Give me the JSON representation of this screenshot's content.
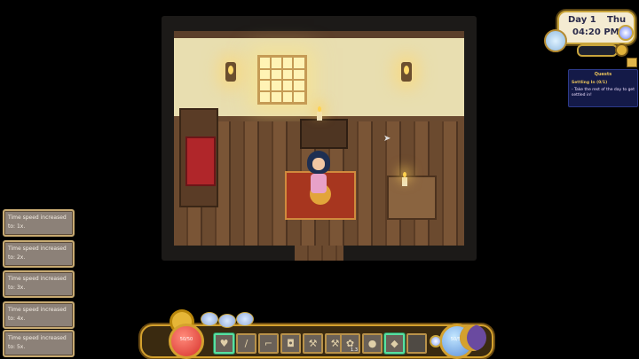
{
  "clock": {
    "day": "Day 1",
    "day_of_week": "Thu",
    "time": "04:20 PM"
  },
  "quests": {
    "header": "Quests",
    "title": "Settling In (0/1)",
    "description": "- Take the rest of the day to get settled in!"
  },
  "notifications": [
    {
      "text": "Time speed increased to: 1x."
    },
    {
      "text": "Time speed increased to: 2x."
    },
    {
      "text": "Time speed increased to: 3x."
    },
    {
      "text": "Time speed increased to: 4x."
    },
    {
      "text": "Time speed increased to: 5x."
    }
  ],
  "hotbar": {
    "health_label": "50/50",
    "mana_label": "50/50",
    "slots": [
      {
        "name": "heart-item",
        "icon": "♥",
        "count": ""
      },
      {
        "name": "wand-tool",
        "icon": "/",
        "count": ""
      },
      {
        "name": "hoe-tool",
        "icon": "⌐",
        "count": ""
      },
      {
        "name": "watering-can-tool",
        "icon": "◘",
        "count": ""
      },
      {
        "name": "axe-tool",
        "icon": "⚒",
        "count": ""
      },
      {
        "name": "hammer-tool",
        "icon": "⚒",
        "count": ""
      },
      {
        "name": "seed-item",
        "icon": "✿",
        "count": "1.3"
      },
      {
        "name": "stone-item",
        "icon": "●",
        "count": ""
      },
      {
        "name": "gem-item",
        "icon": "◆",
        "count": ""
      },
      {
        "name": "empty-slot",
        "icon": "",
        "count": ""
      }
    ]
  },
  "colors": {
    "quest_bg": "#141a48",
    "quest_text": "#e8c25a",
    "notification_bg": "#8c8178",
    "frame_gold": "#d4a12e",
    "health": "#d7322c",
    "mana": "#5a8ed8"
  }
}
